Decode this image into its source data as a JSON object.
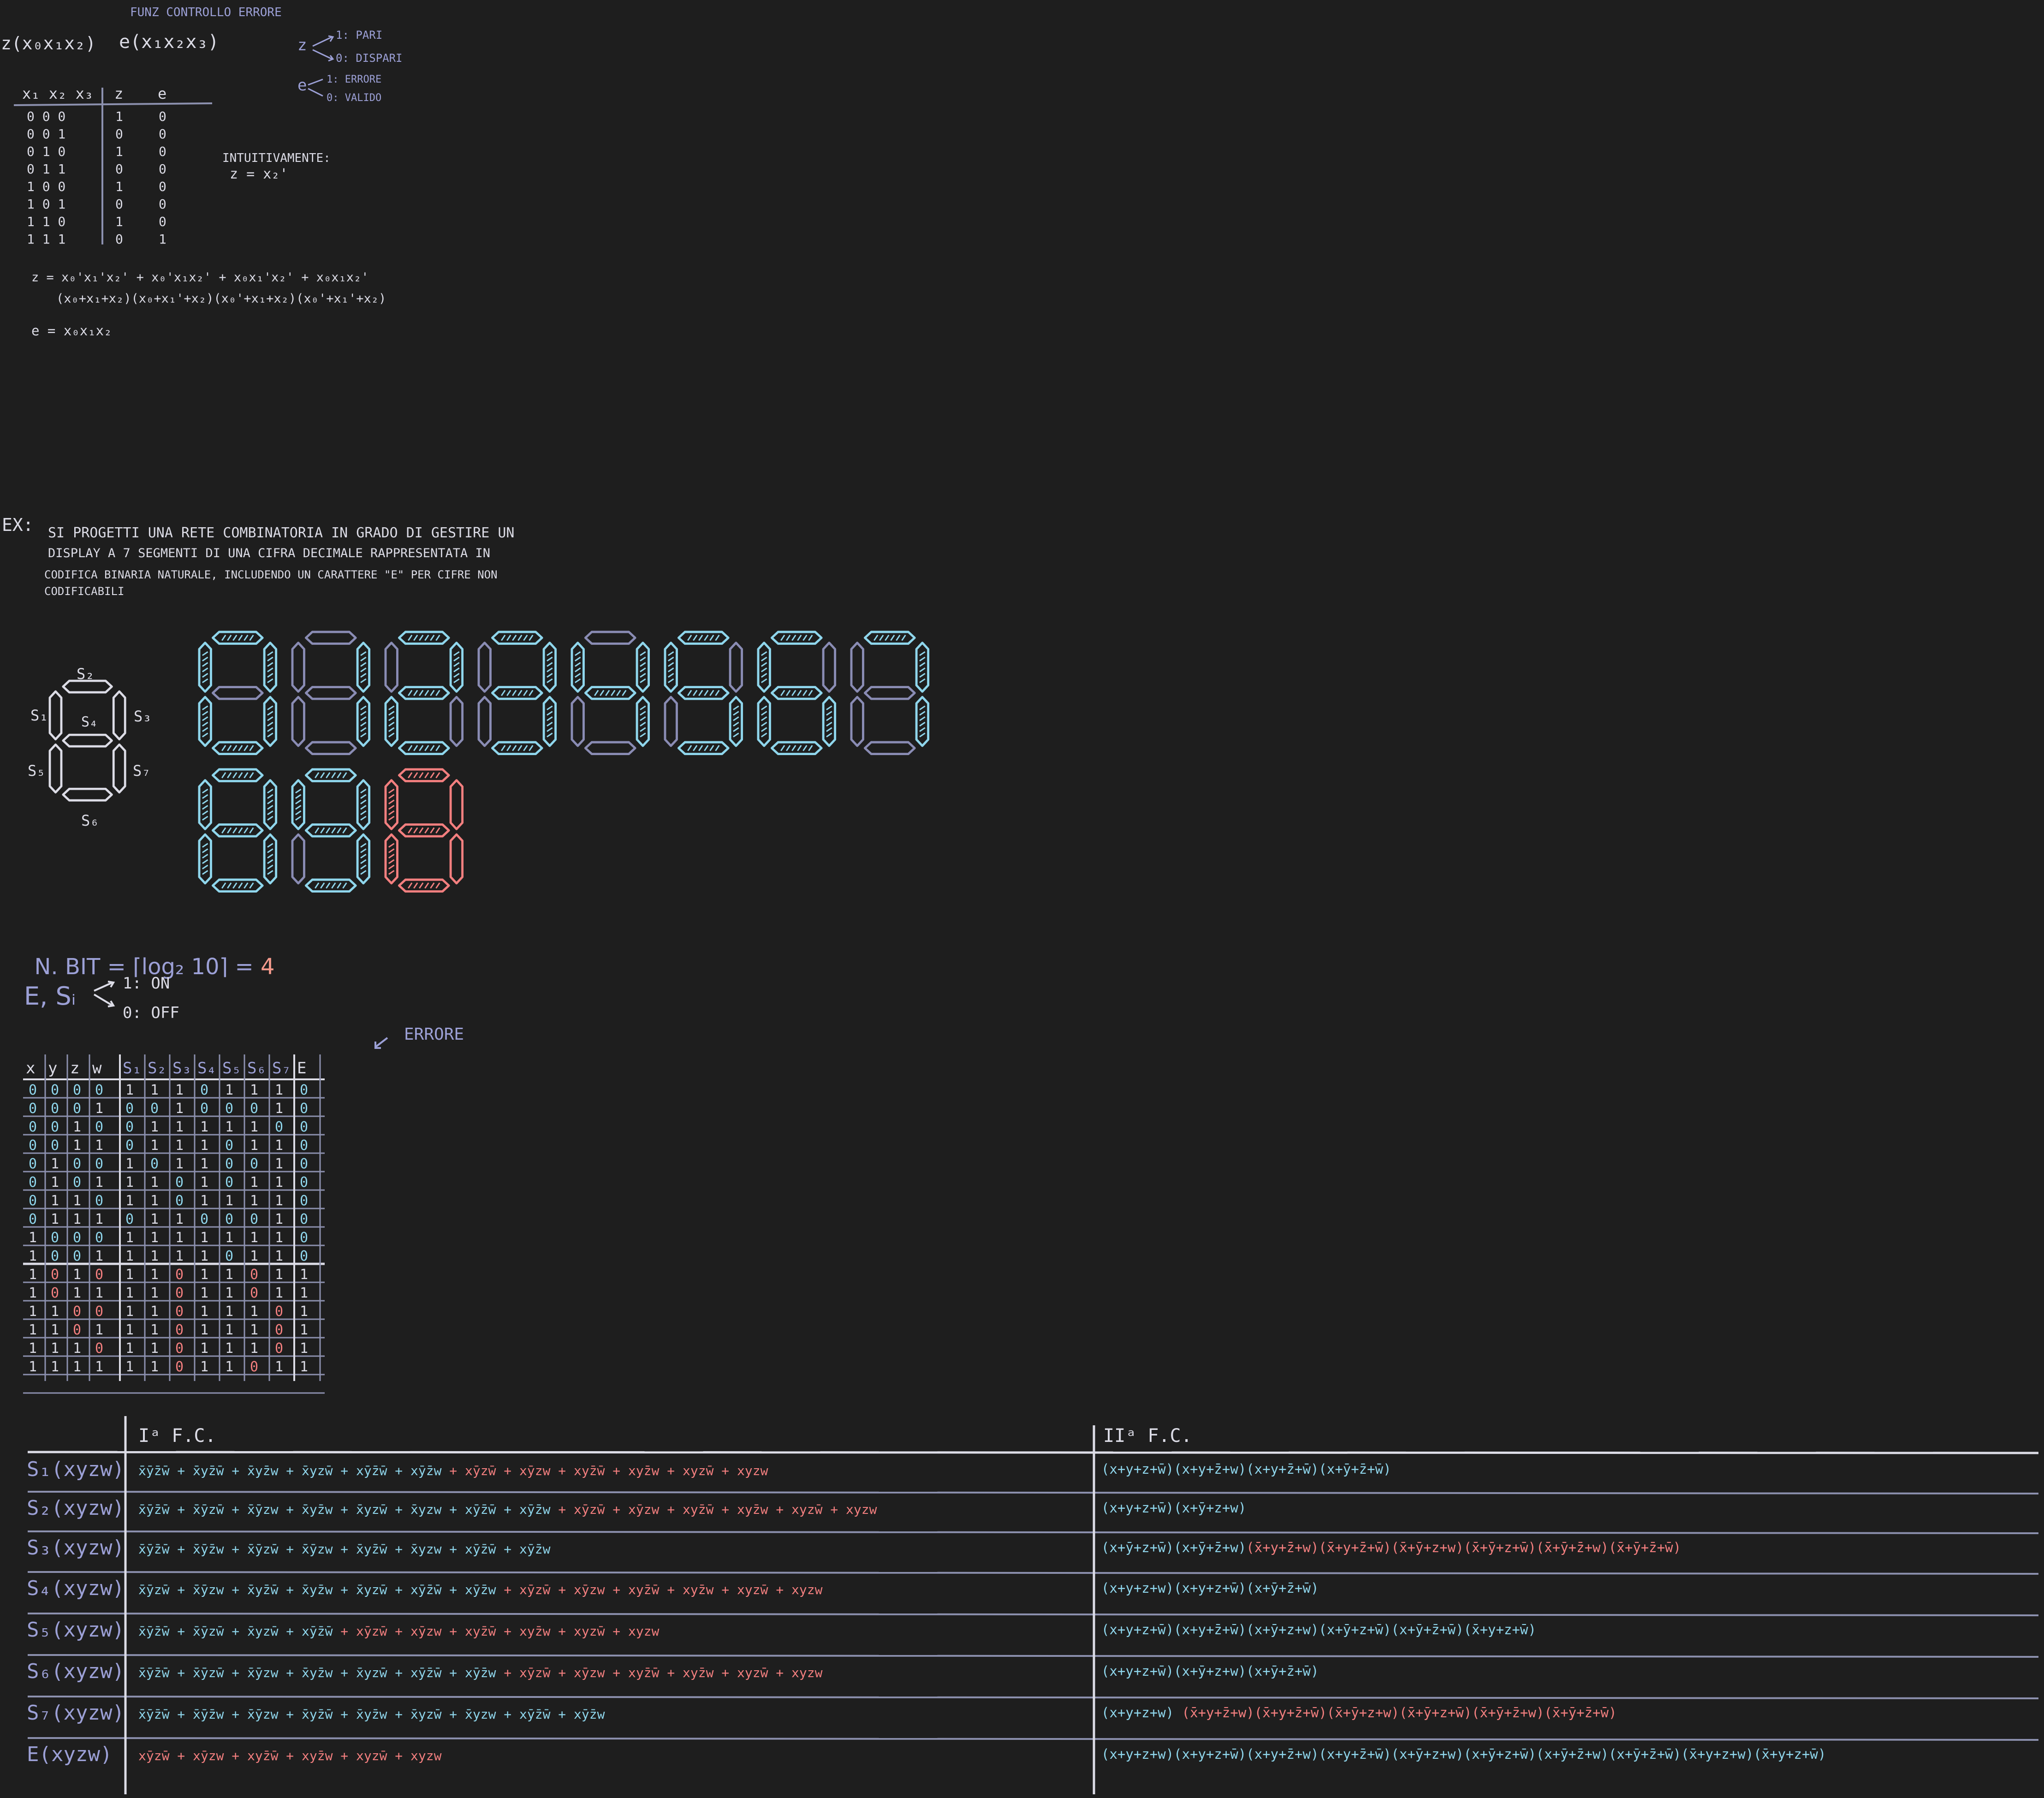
{
  "part1": {
    "title": "FUNZ CONTROLLO ERRORE",
    "func_z": "z(x₀x₁x₂)",
    "func_e": "e(x₁x₂x₃)",
    "legend_z": {
      "var": "z",
      "one": "1: PARI",
      "zero": "0: DISPARI"
    },
    "legend_e": {
      "var": "e",
      "one": "1: ERRORE",
      "zero": "0: VALIDO"
    },
    "table_header": {
      "inputs": "x₁ x₂ x₃",
      "z": "z",
      "e": "e"
    },
    "table_rows": [
      {
        "in": "0 0 0",
        "z": "1",
        "e": "0"
      },
      {
        "in": "0 0 1",
        "z": "0",
        "e": "0"
      },
      {
        "in": "0 1 0",
        "z": "1",
        "e": "0"
      },
      {
        "in": "0 1 1",
        "z": "0",
        "e": "0"
      },
      {
        "in": "1 0 0",
        "z": "1",
        "e": "0"
      },
      {
        "in": "1 0 1",
        "z": "0",
        "e": "0"
      },
      {
        "in": "1 1 0",
        "z": "1",
        "e": "0"
      },
      {
        "in": "1 1 1",
        "z": "0",
        "e": "1"
      }
    ],
    "note_label": "INTUITIVAMENTE:",
    "note_eq": "z = x₂'",
    "eq_z1": "z = x₀'x₁'x₂' + x₀'x₁x₂' + x₀x₁'x₂' + x₀x₁x₂'",
    "eq_z2": "(x₀+x₁+x₂)(x₀+x₁'+x₂)(x₀'+x₁+x₂)(x₀'+x₁'+x₂)",
    "eq_e": "e = x₀x₁x₂"
  },
  "exercise": {
    "label": "EX:",
    "lines": [
      "SI PROGETTI UNA RETE COMBINATORIA IN GRADO DI GESTIRE UN",
      "DISPLAY A 7 SEGMENTI DI UNA CIFRA DECIMALE RAPPRESENTATA IN",
      "CODIFICA BINARIA NATURALE, INCLUDENDO UN CARATTERE \"E\" PER CIFRE NON",
      "CODIFICABILI"
    ]
  },
  "segment_labels": {
    "s1": "S₁",
    "s2": "S₂",
    "s3": "S₃",
    "s4": "S₄",
    "s5": "S₅",
    "s6": "S₆",
    "s7": "S₇"
  },
  "colors": {
    "bg": "#1e1e1e",
    "white": "#dcdce6",
    "blue": "#8fd6ec",
    "slate": "#9ca0d6",
    "red": "#f37f7f",
    "orange": "#f49a8c",
    "gray_line": "#8c90ae",
    "dim_digit": "#8a8cb4"
  },
  "digits_row1": [
    {
      "digit": "0",
      "on": [
        1,
        2,
        3,
        5,
        6,
        7
      ]
    },
    {
      "digit": "1",
      "on": [
        3,
        7
      ]
    },
    {
      "digit": "2",
      "on": [
        2,
        3,
        4,
        5,
        6
      ]
    },
    {
      "digit": "3",
      "on": [
        2,
        3,
        4,
        6,
        7
      ]
    },
    {
      "digit": "4",
      "on": [
        1,
        3,
        4,
        7
      ]
    },
    {
      "digit": "5",
      "on": [
        1,
        2,
        4,
        6,
        7
      ]
    },
    {
      "digit": "6",
      "on": [
        1,
        2,
        4,
        5,
        6,
        7
      ]
    },
    {
      "digit": "7",
      "on": [
        2,
        3,
        7
      ]
    }
  ],
  "digits_row2": [
    {
      "digit": "8",
      "on": [
        1,
        2,
        3,
        4,
        5,
        6,
        7
      ]
    },
    {
      "digit": "9",
      "on": [
        1,
        2,
        3,
        4,
        6,
        7
      ]
    },
    {
      "digit": "E",
      "on": [
        1,
        2,
        4,
        5,
        6
      ]
    }
  ],
  "nbit": {
    "text": "N. BIT = ⌈log₂ 10⌉ = ",
    "value": "4"
  },
  "legend_es": {
    "vars": "E, Sᵢ",
    "one": "1: ON",
    "zero": "0: OFF"
  },
  "errore_label": "ERRORE",
  "truth_table": {
    "headers": [
      "x",
      "y",
      "z",
      "w",
      "S₁",
      "S₂",
      "S₃",
      "S₄",
      "S₅",
      "S₆",
      "S₇",
      "E"
    ],
    "rows": [
      [
        "0",
        "0",
        "0",
        "0",
        "1",
        "1",
        "1",
        "0",
        "1",
        "1",
        "1",
        "0"
      ],
      [
        "0",
        "0",
        "0",
        "1",
        "0",
        "0",
        "1",
        "0",
        "0",
        "0",
        "1",
        "0"
      ],
      [
        "0",
        "0",
        "1",
        "0",
        "0",
        "1",
        "1",
        "1",
        "1",
        "1",
        "0",
        "0"
      ],
      [
        "0",
        "0",
        "1",
        "1",
        "0",
        "1",
        "1",
        "1",
        "0",
        "1",
        "1",
        "0"
      ],
      [
        "0",
        "1",
        "0",
        "0",
        "1",
        "0",
        "1",
        "1",
        "0",
        "0",
        "1",
        "0"
      ],
      [
        "0",
        "1",
        "0",
        "1",
        "1",
        "1",
        "0",
        "1",
        "0",
        "1",
        "1",
        "0"
      ],
      [
        "0",
        "1",
        "1",
        "0",
        "1",
        "1",
        "0",
        "1",
        "1",
        "1",
        "1",
        "0"
      ],
      [
        "0",
        "1",
        "1",
        "1",
        "0",
        "1",
        "1",
        "0",
        "0",
        "0",
        "1",
        "0"
      ],
      [
        "1",
        "0",
        "0",
        "0",
        "1",
        "1",
        "1",
        "1",
        "1",
        "1",
        "1",
        "0"
      ],
      [
        "1",
        "0",
        "0",
        "1",
        "1",
        "1",
        "1",
        "1",
        "0",
        "1",
        "1",
        "0"
      ],
      [
        "1",
        "0",
        "1",
        "0",
        "1",
        "1",
        "0",
        "1",
        "1",
        "0",
        "1",
        "1"
      ],
      [
        "1",
        "0",
        "1",
        "1",
        "1",
        "1",
        "0",
        "1",
        "1",
        "0",
        "1",
        "1"
      ],
      [
        "1",
        "1",
        "0",
        "0",
        "1",
        "1",
        "0",
        "1",
        "1",
        "1",
        "0",
        "1"
      ],
      [
        "1",
        "1",
        "0",
        "1",
        "1",
        "1",
        "0",
        "1",
        "1",
        "1",
        "0",
        "1"
      ],
      [
        "1",
        "1",
        "1",
        "0",
        "1",
        "1",
        "0",
        "1",
        "1",
        "1",
        "0",
        "1"
      ],
      [
        "1",
        "1",
        "1",
        "1",
        "1",
        "1",
        "0",
        "1",
        "1",
        "0",
        "1",
        "1"
      ]
    ]
  },
  "forms": {
    "head1": "Iᵃ F.C.",
    "head2": "IIᵃ F.C.",
    "rows": [
      {
        "label": "S₁(xyzw)",
        "f1": "x̄ȳz̄w̄ + x̄yz̄w̄ + x̄yz̄w + x̄yzw̄ + xȳz̄w̄ + xȳz̄w ",
        "f1r": "+ xȳzw̄ + xȳzw + xyz̄w̄ + xyz̄w + xyzw̄ + xyzw",
        "f2": "(x+y+z+w̄)(x+y+z̄+w)(x+y+z̄+w̄)(x+ȳ+z̄+w̄)",
        "f2r": ""
      },
      {
        "label": "S₂(xyzw)",
        "f1": "x̄ȳz̄w̄ + x̄ȳzw̄ + x̄ȳzw + x̄yz̄w + x̄yzw̄ + x̄yzw + xȳz̄w̄ + xȳz̄w ",
        "f1r": "+ xȳzw̄ + xȳzw + xyz̄w̄ + xyz̄w + xyzw̄ + xyzw",
        "f2": "(x+y+z+w̄)(x+ȳ+z+w)",
        "f2r": ""
      },
      {
        "label": "S₃(xyzw)",
        "f1": "x̄ȳz̄w̄ + x̄ȳz̄w + x̄ȳzw̄ + x̄ȳzw + x̄yz̄w̄ + x̄yzw + xȳz̄w̄ + xȳz̄w",
        "f1r": "",
        "f2": "(x+ȳ+z+w̄)(x+ȳ+z̄+w)",
        "f2r": "(x̄+y+z̄+w)(x̄+y+z̄+w̄)(x̄+ȳ+z+w)(x̄+ȳ+z+w̄)(x̄+ȳ+z̄+w)(x̄+ȳ+z̄+w̄)"
      },
      {
        "label": "S₄(xyzw)",
        "f1": "x̄ȳzw̄ + x̄ȳzw + x̄yz̄w̄ + x̄yz̄w + x̄yzw̄ + xȳz̄w̄ + xȳz̄w ",
        "f1r": "+ xȳzw̄ + xȳzw + xyz̄w̄ + xyz̄w + xyzw̄ + xyzw",
        "f2": "(x+y+z+w)(x+y+z+w̄)(x+ȳ+z̄+w̄)",
        "f2r": ""
      },
      {
        "label": "S₅(xyzw)",
        "f1": "x̄ȳz̄w̄ + x̄ȳzw̄ + x̄yzw̄ + xȳz̄w̄ ",
        "f1r": "+ xȳzw̄ + xȳzw + xyz̄w̄ + xyz̄w + xyzw̄ + xyzw",
        "f2": "(x+y+z+w̄)(x+y+z̄+w̄)(x+ȳ+z+w)(x+ȳ+z+w̄)(x+ȳ+z̄+w̄)(x̄+y+z+w̄)",
        "f2r": ""
      },
      {
        "label": "S₆(xyzw)",
        "f1": "x̄ȳz̄w̄ + x̄ȳzw̄ + x̄ȳzw + x̄yz̄w + x̄yzw̄ + xȳz̄w̄ + xȳz̄w ",
        "f1r": "+ xȳzw̄ + xȳzw + xyz̄w̄ + xyz̄w + xyzw̄ + xyzw",
        "f2": "(x+y+z+w̄)(x+ȳ+z+w)(x+ȳ+z̄+w̄)",
        "f2r": ""
      },
      {
        "label": "S₇(xyzw)",
        "f1": "x̄ȳz̄w̄ + x̄ȳz̄w + x̄ȳzw + x̄yz̄w̄ + x̄yz̄w + x̄yzw̄ + x̄yzw + xȳz̄w̄ + xȳz̄w",
        "f1r": "",
        "f2": "(x+y+z+w) ",
        "f2r": "(x̄+y+z̄+w)(x̄+y+z̄+w̄)(x̄+ȳ+z+w)(x̄+ȳ+z+w̄)(x̄+ȳ+z̄+w)(x̄+ȳ+z̄+w̄)"
      },
      {
        "label": "E(xyzw)",
        "f1": "",
        "f1r": "xȳzw̄ + xȳzw + xyz̄w̄ + xyz̄w + xyzw̄ + xyzw",
        "f2": "(x+y+z+w)(x+y+z+w̄)(x+y+z̄+w)(x+y+z̄+w̄)(x+ȳ+z+w)(x+ȳ+z+w̄)(x+ȳ+z̄+w)(x+ȳ+z̄+w̄)(x̄+y+z+w)(x̄+y+z+w̄)",
        "f2r": ""
      }
    ]
  }
}
